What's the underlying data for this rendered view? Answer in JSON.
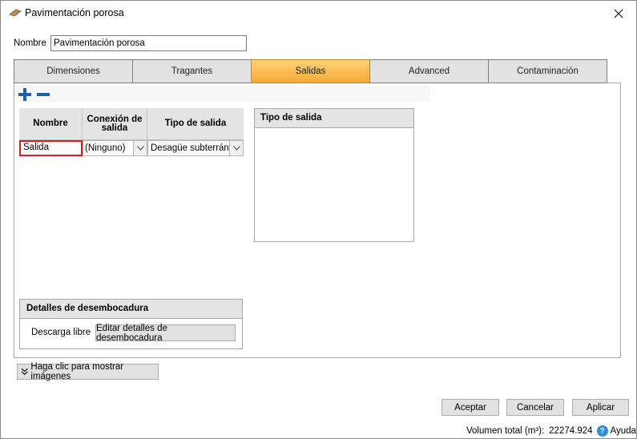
{
  "window": {
    "title": "Pavimentación porosa"
  },
  "name_field": {
    "label": "Nombre",
    "value": "Pavimentación porosa"
  },
  "tabs": [
    {
      "label": "Dimensiones",
      "active": false
    },
    {
      "label": "Tragantes",
      "active": false
    },
    {
      "label": "Salidas",
      "active": true
    },
    {
      "label": "Advanced",
      "active": false
    },
    {
      "label": "Contaminación",
      "active": false
    }
  ],
  "outlets_grid": {
    "columns": [
      "Nombre",
      "Conexión de salida",
      "Tipo de salida"
    ],
    "rows": [
      {
        "name": "Salida",
        "connection": "(Ninguno)",
        "type": "Desagüe subterráneo"
      }
    ]
  },
  "outlet_type_panel": {
    "title": "Tipo de salida"
  },
  "outfall_details": {
    "title": "Detalles de desembocadura",
    "type_label": "Descarga libre",
    "edit_button": "Editar detalles de desembocadura"
  },
  "show_images_button": "Haga clic para mostrar imágenes",
  "buttons": {
    "accept": "Aceptar",
    "cancel": "Cancelar",
    "apply": "Aplicar"
  },
  "status": {
    "volume_label": "Volumen total (m³):",
    "volume_value": "22274.924",
    "help_label": "Ayuda"
  },
  "colors": {
    "active_tab": "#f6a935",
    "error_border": "#d11f24",
    "add_remove_icon": "#1f5fa8"
  }
}
